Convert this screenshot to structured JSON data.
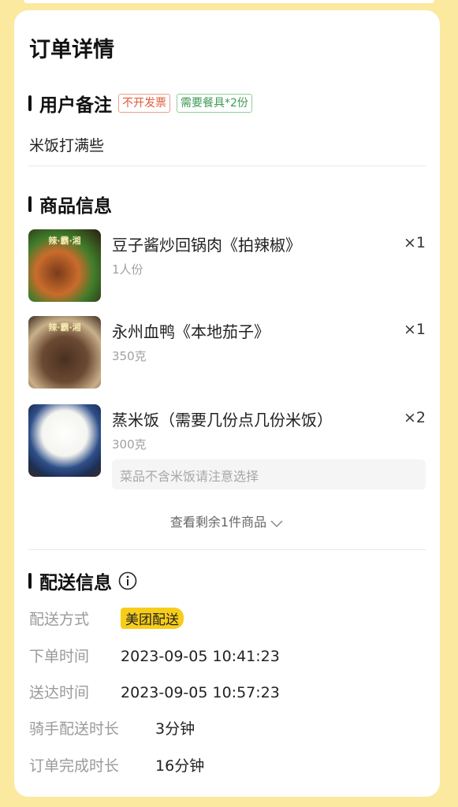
{
  "order": {
    "title": "订单详情",
    "remarks": {
      "title": "用户备注",
      "tag_invoice": "不开发票",
      "tag_tableware": "需要餐具*2份",
      "text": "米饭打满些"
    },
    "products": {
      "title": "商品信息",
      "items": [
        {
          "name": "豆子酱炒回锅肉《拍辣椒》",
          "spec": "1人份",
          "qty": "×1",
          "image": "food-stir-fried-pork"
        },
        {
          "name": "永州血鸭《本地茄子》",
          "spec": "350克",
          "qty": "×1",
          "image": "food-blood-duck"
        },
        {
          "name": "蒸米饭（需要几份点几份米饭）",
          "spec": "300克",
          "qty": "×2",
          "image": "food-steamed-rice",
          "note": "菜品不含米饭请注意选择"
        }
      ],
      "more_label": "查看剩余1件商品"
    },
    "delivery": {
      "title": "配送信息",
      "rows": {
        "method_label": "配送方式",
        "method_value": "美团配送",
        "order_time_label": "下单时间",
        "order_time_value": "2023-09-05 10:41:23",
        "arrive_time_label": "送达时间",
        "arrive_time_value": "2023-09-05 10:57:23",
        "rider_duration_label": "骑手配送时长",
        "rider_duration_value": "3分钟",
        "complete_duration_label": "订单完成时长",
        "complete_duration_value": "16分钟"
      }
    }
  },
  "colors": {
    "background": "#fbe9a0",
    "accent_yellow": "#f7cd1a",
    "tag_red": "#e15a3a",
    "tag_green": "#3e9a55"
  }
}
